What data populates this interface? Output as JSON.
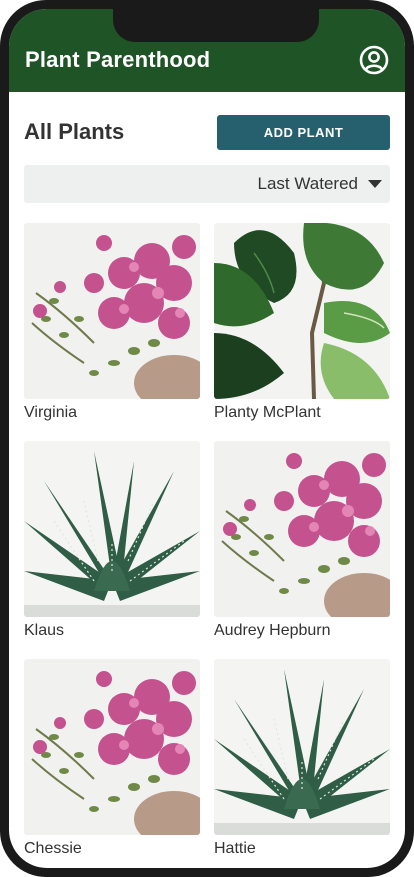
{
  "app": {
    "title": "Plant Parenthood",
    "profile_icon": "user-circle-icon"
  },
  "colors": {
    "header": "#1f5426",
    "button": "#26606e",
    "select_bg": "#eef0ef"
  },
  "page": {
    "title": "All Plants",
    "add_button_label": "ADD PLANT"
  },
  "sort": {
    "selected": "Last Watered"
  },
  "plants": [
    {
      "name": "Virginia",
      "image": "pink-flowering-succulent"
    },
    {
      "name": "Planty McPlant",
      "image": "fiddle-leaf-fig"
    },
    {
      "name": "Klaus",
      "image": "zebra-haworthia"
    },
    {
      "name": "Audrey Hepburn",
      "image": "pink-flowering-succulent"
    },
    {
      "name": "Chessie",
      "image": "pink-flowering-succulent"
    },
    {
      "name": "Hattie",
      "image": "zebra-haworthia"
    }
  ]
}
